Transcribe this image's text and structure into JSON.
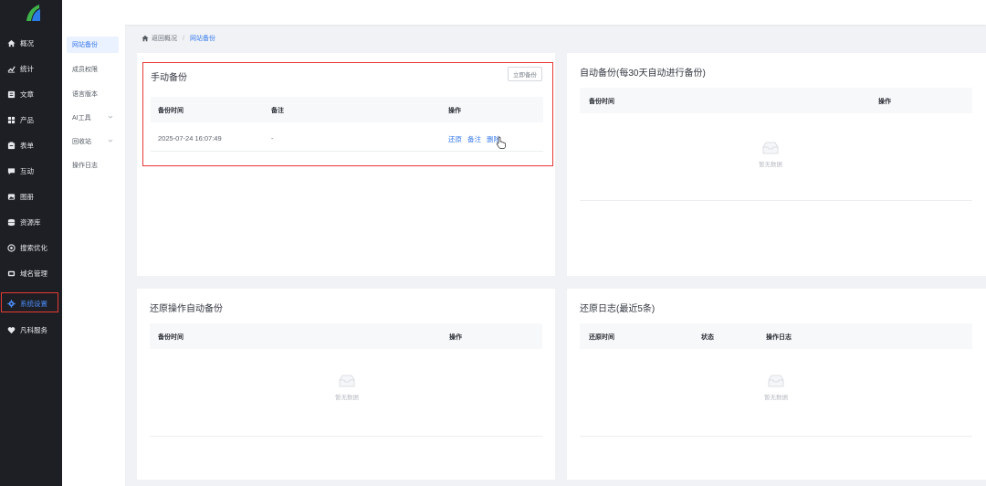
{
  "nav": {
    "items": [
      {
        "label": "概况",
        "icon": "home-icon"
      },
      {
        "label": "统计",
        "icon": "chart-icon"
      },
      {
        "label": "文章",
        "icon": "article-icon"
      },
      {
        "label": "产品",
        "icon": "product-icon"
      },
      {
        "label": "表单",
        "icon": "form-icon"
      },
      {
        "label": "互动",
        "icon": "chat-icon"
      },
      {
        "label": "图册",
        "icon": "gallery-icon"
      },
      {
        "label": "资源库",
        "icon": "database-icon"
      },
      {
        "label": "搜索优化",
        "icon": "seo-icon"
      },
      {
        "label": "域名管理",
        "icon": "domain-icon"
      },
      {
        "label": "系统设置",
        "icon": "gear-icon"
      },
      {
        "label": "凡科服务",
        "icon": "heart-icon"
      }
    ],
    "active_index": 10
  },
  "subnav": {
    "items": [
      {
        "label": "网站备份"
      },
      {
        "label": "成员权限"
      },
      {
        "label": "语言版本"
      },
      {
        "label": "AI工具"
      },
      {
        "label": "回收站"
      },
      {
        "label": "操作日志"
      }
    ]
  },
  "breadcrumb": {
    "back": "返回概况",
    "separator": "/",
    "current": "网站备份"
  },
  "manual": {
    "title": "手动备份",
    "button": "立即备份",
    "headers": {
      "time": "备份时间",
      "note": "备注",
      "op": "操作"
    },
    "row": {
      "time": "2025-07-24 16:07:49",
      "note": "-",
      "restore": "还原",
      "remark": "备注",
      "delete": "删除"
    }
  },
  "auto": {
    "title": "自动备份(每30天自动进行备份)",
    "headers": {
      "time": "备份时间",
      "op": "操作"
    },
    "empty": "暂无数据"
  },
  "restore_auto": {
    "title": "还原操作自动备份",
    "headers": {
      "time": "备份时间",
      "op": "操作"
    },
    "empty": "暂无数据"
  },
  "restore_log": {
    "title": "还原日志(最近5条)",
    "headers": {
      "time": "还原时间",
      "status": "状态",
      "log": "操作日志"
    },
    "empty": "暂无数据"
  },
  "colors": {
    "accent": "#3b7cf0",
    "highlight": "#e53935",
    "sidebar": "#1e1f24"
  }
}
